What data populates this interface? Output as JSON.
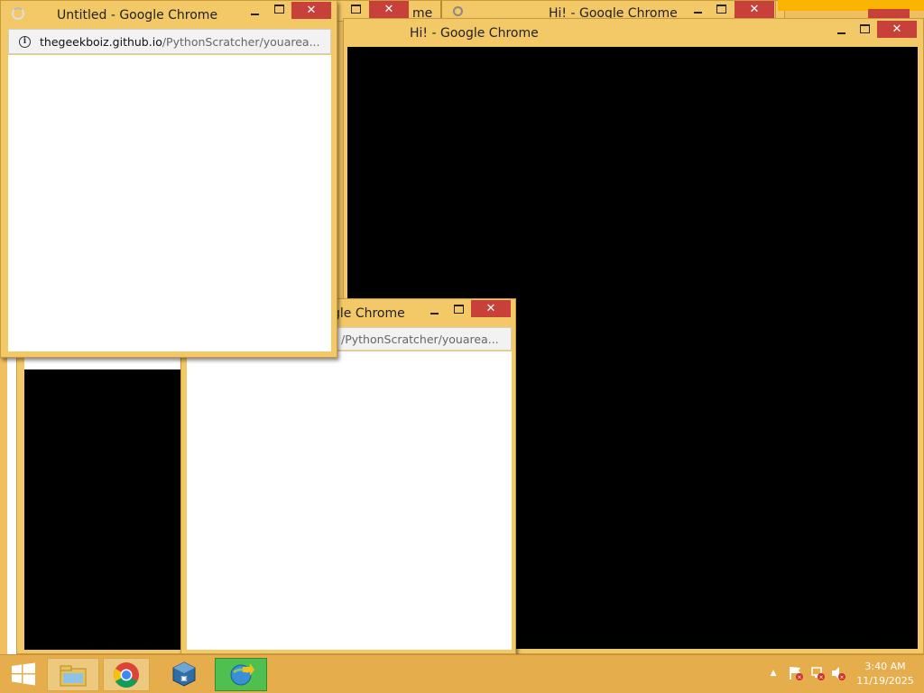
{
  "windows": {
    "untitled": {
      "title": "Untitled - Google Chrome",
      "address_host": "thegeekboiz.github.io",
      "address_path": "/PythonScratcher/youarea..."
    },
    "hi_main": {
      "title": "Hi! - Google Chrome"
    },
    "hi_back": {
      "title": "Hi! - Google Chrome"
    },
    "back_tab_fragment": {
      "title": "me"
    },
    "mid": {
      "title": "gle Chrome",
      "address_path": "/PythonScratcher/youarea..."
    }
  },
  "taskbar": {
    "apps": [
      {
        "name": "file-explorer"
      },
      {
        "name": "chrome"
      },
      {
        "name": "virtualbox"
      },
      {
        "name": "internet-download-manager"
      }
    ],
    "clock_time": "3:40 AM",
    "clock_date": "11/19/2025"
  },
  "colors": {
    "frame": "#f3c867",
    "close": "#c7403a",
    "taskbar": "#e6ad4d"
  }
}
